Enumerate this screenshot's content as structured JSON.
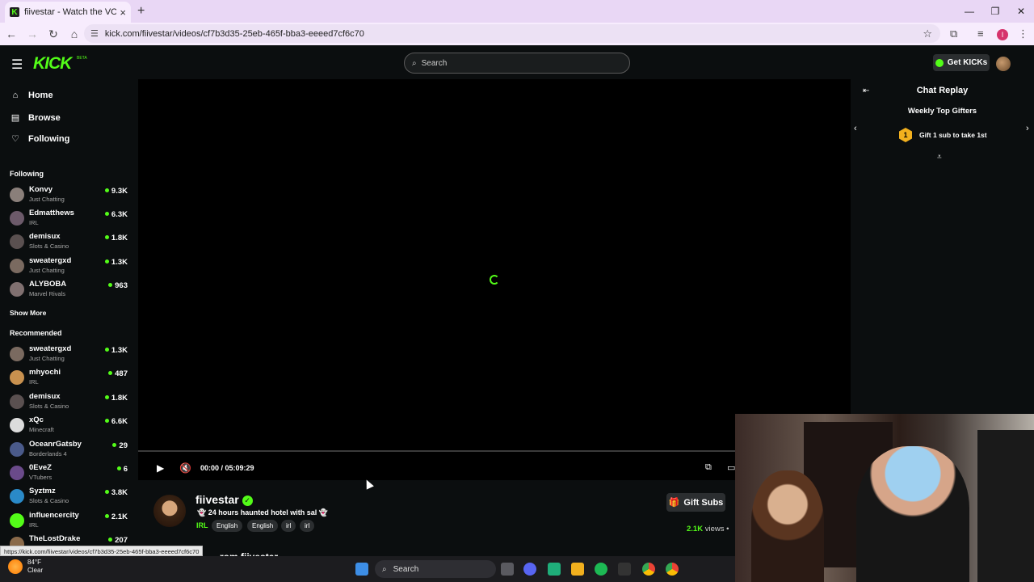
{
  "browser": {
    "tab_title": "fiivestar - Watch the VOD on Ki",
    "tab_close": "×",
    "new_tab": "+",
    "url": "kick.com/fiivestar/videos/cf7b3d35-25eb-465f-bba3-eeeed7cf6c70",
    "status_link": "https://kick.com/fiivestar/videos/cf7b3d35-25eb-465f-bba3-eeeed7cf6c70",
    "profile_initial": "I"
  },
  "header": {
    "logo": "KICK",
    "beta": "BETA",
    "search_placeholder": "Search",
    "get_kicks": "Get KICKs"
  },
  "sidebar": {
    "nav": [
      {
        "label": "Home",
        "icon": "home-icon"
      },
      {
        "label": "Browse",
        "icon": "browse-icon"
      },
      {
        "label": "Following",
        "icon": "heart-icon"
      }
    ],
    "following_title": "Following",
    "following": [
      {
        "name": "Konvy",
        "category": "Just Chatting",
        "viewers": "9.3K"
      },
      {
        "name": "Edmatthews",
        "category": "IRL",
        "viewers": "6.3K"
      },
      {
        "name": "demisux",
        "category": "Slots & Casino",
        "viewers": "1.8K"
      },
      {
        "name": "sweatergxd",
        "category": "Just Chatting",
        "viewers": "1.3K"
      },
      {
        "name": "ALYBOBA",
        "category": "Marvel Rivals",
        "viewers": "963"
      }
    ],
    "show_more": "Show More",
    "recommended_title": "Recommended",
    "recommended": [
      {
        "name": "sweatergxd",
        "category": "Just Chatting",
        "viewers": "1.3K"
      },
      {
        "name": "mhyochi",
        "category": "IRL",
        "viewers": "487"
      },
      {
        "name": "demisux",
        "category": "Slots & Casino",
        "viewers": "1.8K"
      },
      {
        "name": "xQc",
        "category": "Minecraft",
        "viewers": "6.6K"
      },
      {
        "name": "OceanrGatsby",
        "category": "Borderlands 4",
        "viewers": "29"
      },
      {
        "name": "0EveZ",
        "category": "VTubers",
        "viewers": "6"
      },
      {
        "name": "Syztmz",
        "category": "Slots & Casino",
        "viewers": "3.8K"
      },
      {
        "name": "influencercity",
        "category": "IRL",
        "viewers": "2.1K"
      },
      {
        "name": "TheLostDrake",
        "category": "",
        "viewers": "207"
      }
    ]
  },
  "player": {
    "time": "00:00 / 05:09:29",
    "progress": 0
  },
  "chat": {
    "title": "Chat Replay",
    "weekly_title": "Weekly Top Gifters",
    "rank": "1",
    "gift_prompt": "Gift 1 sub to take 1st"
  },
  "stream": {
    "streamer": "fiivestar",
    "title": "👻 24 hours haunted hotel with sal 👻",
    "category": "IRL",
    "tags": [
      "English",
      "English",
      "irl",
      "irl"
    ],
    "gift_subs": "Gift Subs",
    "views_count": "2.1K",
    "views_label": "views •",
    "more_from": "...rom fiivestar"
  },
  "taskbar": {
    "temp": "84°F",
    "condition": "Clear",
    "search": "Search"
  },
  "colors": {
    "brand_green": "#53fc18",
    "background": "#0b0e0f"
  }
}
